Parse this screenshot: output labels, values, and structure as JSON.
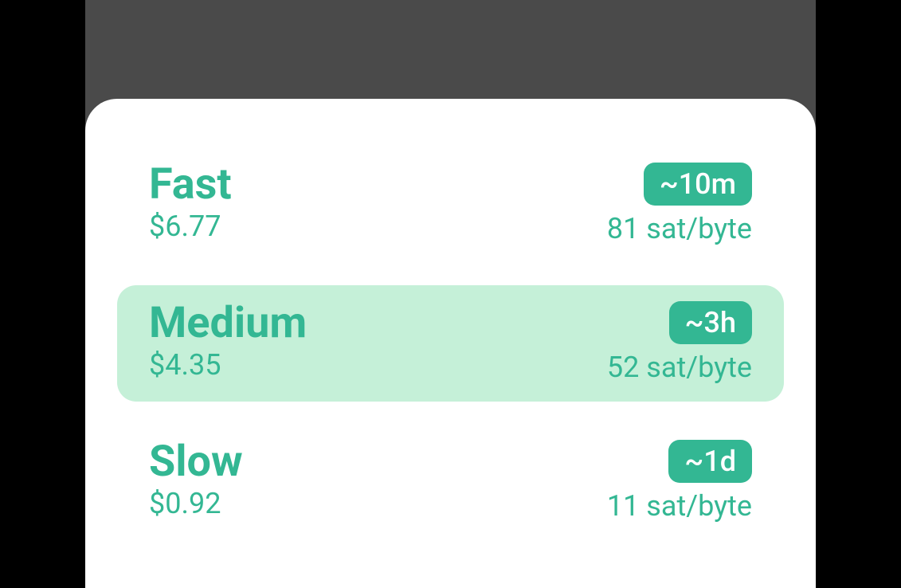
{
  "options": [
    {
      "id": "fast",
      "label": "Fast",
      "cost": "$6.77",
      "time": "~10m",
      "rate": "81 sat/byte",
      "selected": false
    },
    {
      "id": "medium",
      "label": "Medium",
      "cost": "$4.35",
      "time": "~3h",
      "rate": "52 sat/byte",
      "selected": true
    },
    {
      "id": "slow",
      "label": "Slow",
      "cost": "$0.92",
      "time": "~1d",
      "rate": "11 sat/byte",
      "selected": false
    }
  ],
  "colors": {
    "accent": "#33b793",
    "selectedBg": "#c5f0d8",
    "sheetBg": "#fff",
    "outerBg": "#4a4a4a",
    "pageBg": "#000"
  }
}
